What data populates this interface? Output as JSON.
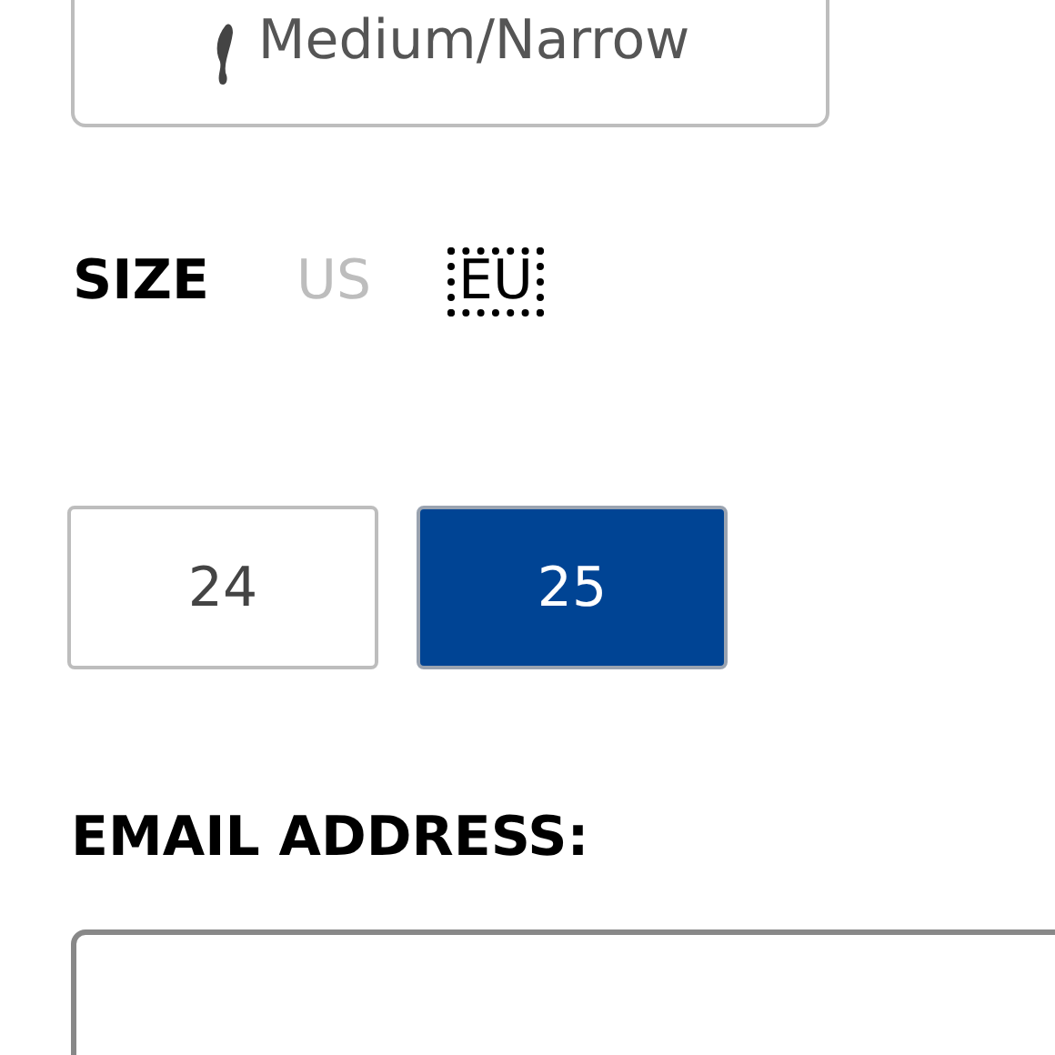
{
  "width_option": {
    "label": "Medium/Narrow"
  },
  "size": {
    "label": "SIZE",
    "units": [
      {
        "label": "US",
        "selected": false
      },
      {
        "label": "EU",
        "selected": true
      }
    ],
    "options": [
      {
        "label": "24",
        "selected": false
      },
      {
        "label": "25",
        "selected": true
      }
    ]
  },
  "email": {
    "label": "EMAIL ADDRESS:"
  }
}
